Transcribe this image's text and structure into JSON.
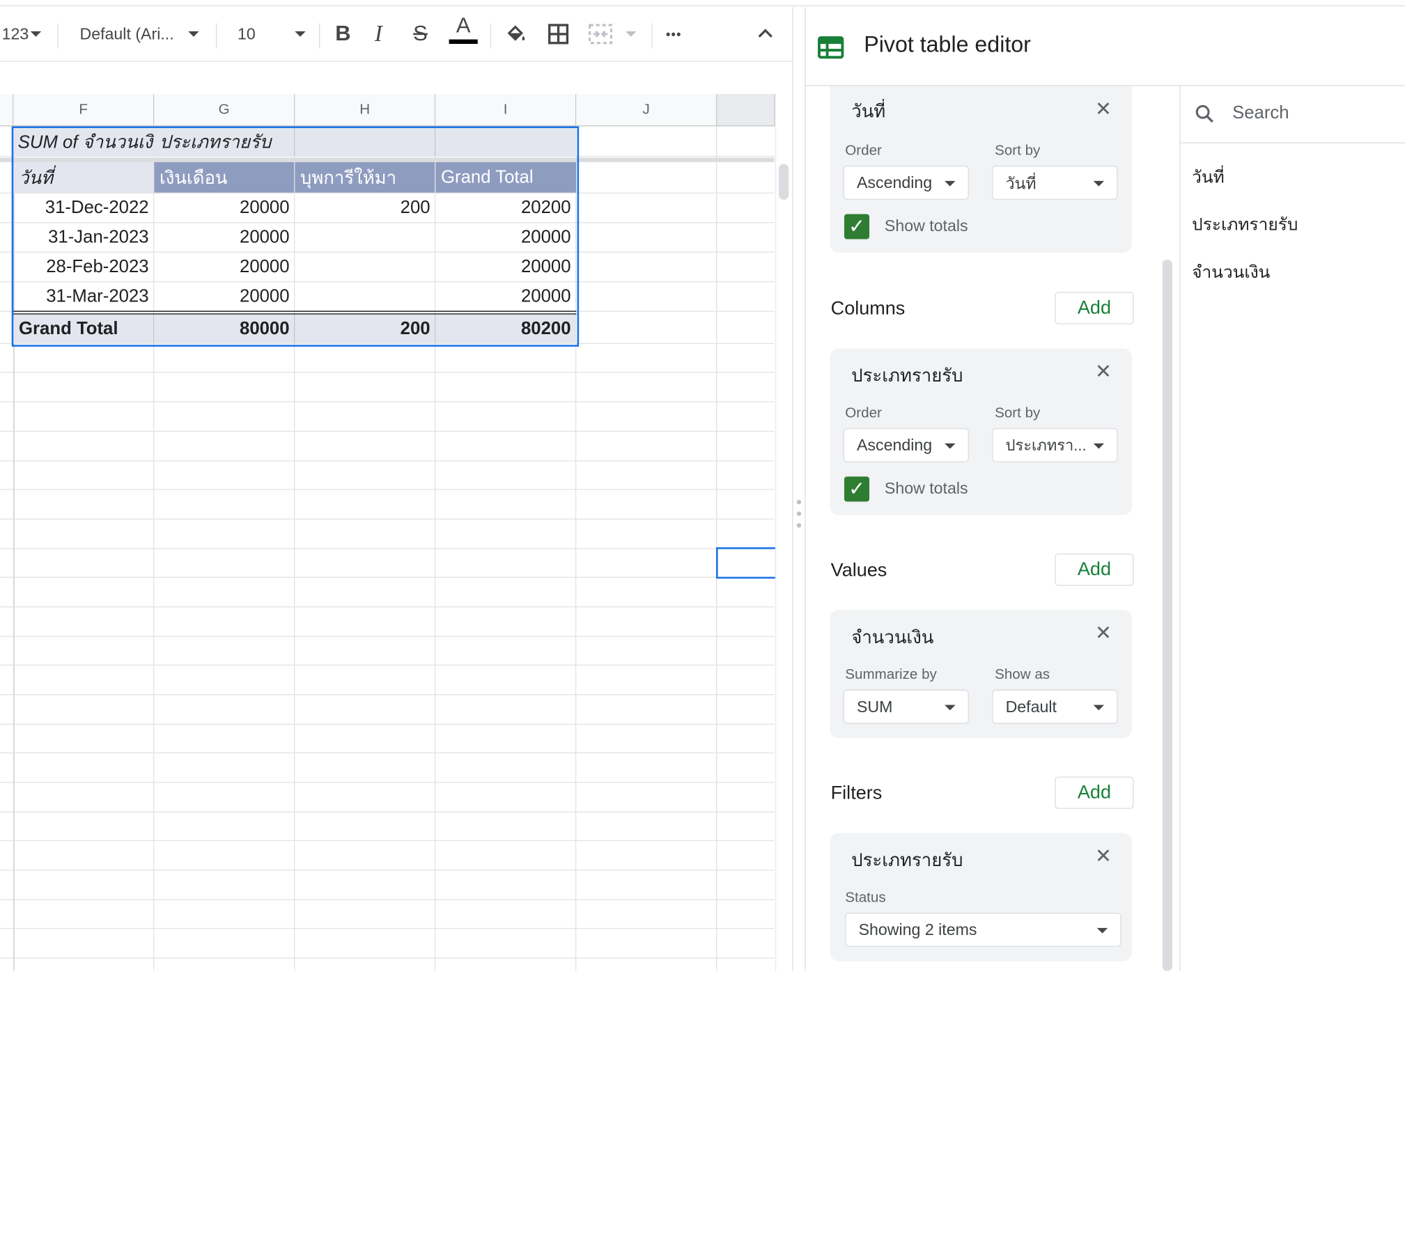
{
  "toolbar": {
    "number_format": "123",
    "font_family": "Default (Ari...",
    "font_size": "10",
    "bold": "B",
    "italic": "I",
    "strike": "S",
    "text_color": "A",
    "more": "•••",
    "collapse": "⌃"
  },
  "sheet": {
    "columns": [
      "F",
      "G",
      "H",
      "I",
      "J"
    ],
    "pivot_title_left": "SUM of จำนวนเงิ",
    "pivot_title_right": "ประเภทรายรับ",
    "header": [
      "วันที่",
      "เงินเดือน",
      "บุพการีให้มา",
      "Grand Total"
    ],
    "rows": [
      [
        "31-Dec-2022",
        "20000",
        "200",
        "20200"
      ],
      [
        "31-Jan-2023",
        "20000",
        "",
        "20000"
      ],
      [
        "28-Feb-2023",
        "20000",
        "",
        "20000"
      ],
      [
        "31-Mar-2023",
        "20000",
        "",
        "20000"
      ]
    ],
    "total": [
      "Grand Total",
      "80000",
      "200",
      "80200"
    ]
  },
  "panel": {
    "title": "Pivot table editor",
    "search_placeholder": "Search",
    "fields": [
      "วันที่",
      "ประเภทรายรับ",
      "จำนวนเงิน"
    ],
    "rows_card": {
      "title": "วันที่",
      "order_label": "Order",
      "order_value": "Ascending",
      "sortby_label": "Sort by",
      "sortby_value": "วันที่",
      "show_totals": "Show totals"
    },
    "columns": {
      "heading": "Columns",
      "add": "Add",
      "card": {
        "title": "ประเภทรายรับ",
        "order_label": "Order",
        "order_value": "Ascending",
        "sortby_label": "Sort by",
        "sortby_value": "ประเภทรา...",
        "show_totals": "Show totals"
      }
    },
    "values": {
      "heading": "Values",
      "add": "Add",
      "card": {
        "title": "จำนวนเงิน",
        "summarize_label": "Summarize by",
        "summarize_value": "SUM",
        "showas_label": "Show as",
        "showas_value": "Default"
      }
    },
    "filters": {
      "heading": "Filters",
      "add": "Add",
      "card": {
        "title": "ประเภทรายรับ",
        "status_label": "Status",
        "status_value": "Showing 2 items"
      }
    }
  },
  "colors": {
    "pivot_header": "#8e9cc0",
    "pivot_light": "#e3e6ee",
    "selection": "#1a73e8",
    "add_green": "#188038",
    "check_green": "#2e7d32",
    "sheets_icon_green": "#188038"
  }
}
